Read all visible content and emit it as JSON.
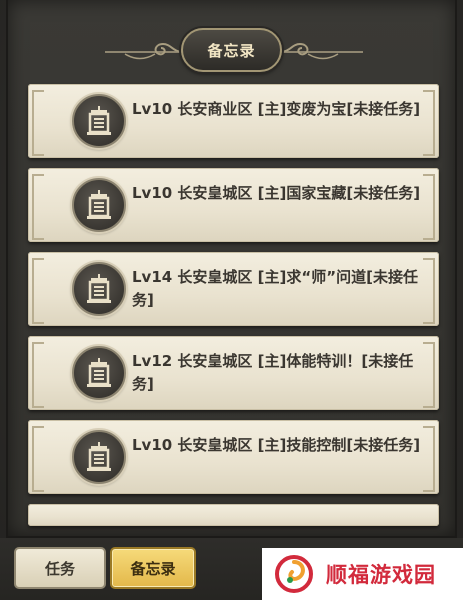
{
  "header": {
    "title": "备忘录"
  },
  "quests": [
    {
      "text": "Lv10 长安商业区 [主]变废为宝[未接任务]"
    },
    {
      "text": "Lv10 长安皇城区 [主]国家宝藏[未接任务]"
    },
    {
      "text": "Lv14 长安皇城区 [主]求“师”问道[未接任务]"
    },
    {
      "text": "Lv12 长安皇城区 [主]体能特训！[未接任务]"
    },
    {
      "text": "Lv10 长安皇城区 [主]技能控制[未接任务]"
    }
  ],
  "quest_icon": "scroll-notice-icon",
  "tabs": {
    "tasks": "任务",
    "memo": "备忘录"
  },
  "watermark": {
    "text": "顺福游戏园",
    "logo": "swirl-logo-icon"
  },
  "colors": {
    "panel_bg": "#33322e",
    "card_bg": "#ece6d4",
    "text_dark": "#3a3630",
    "active_tab": "#f2cc5c",
    "watermark_red": "#d22a3c"
  }
}
